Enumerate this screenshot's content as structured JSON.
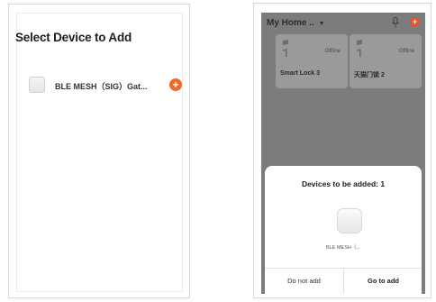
{
  "left_screen": {
    "title": "Select Device to Add",
    "device": {
      "name": "BLE MESH（SIG）Gat...",
      "add_icon": "plus-circle-icon"
    }
  },
  "right_screen": {
    "home_title": "My Home .. ",
    "chevron": "⌄",
    "cards": [
      {
        "name": "Smart Lock 3",
        "status": "Offline"
      },
      {
        "name": "天猫门锁 2",
        "status": "Offline"
      }
    ],
    "sheet": {
      "title": "Devices to be added: 1",
      "device_name": "BLE MESH（...",
      "cancel_label": "Do not add",
      "confirm_label": "Go to add"
    }
  },
  "colors": {
    "accent": "#ef6a2a",
    "overlay": "#7c7c7c"
  }
}
